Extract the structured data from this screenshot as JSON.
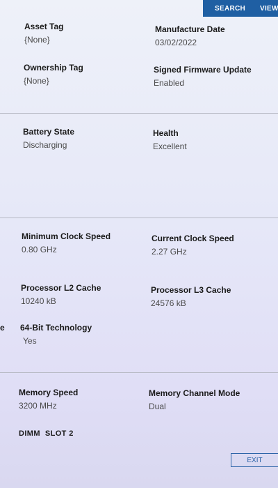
{
  "toolbar": {
    "search_label": "SEARCH",
    "view_all_label": "VIEW A"
  },
  "sections": {
    "asset": {
      "asset_tag": {
        "label": "Asset Tag",
        "value": "{None}"
      },
      "manufacture_date": {
        "label": "Manufacture Date",
        "value": "03/02/2022"
      },
      "ownership_tag": {
        "label": "Ownership Tag",
        "value": "{None}"
      },
      "signed_firmware_update": {
        "label": "Signed Firmware Update",
        "value": "Enabled"
      }
    },
    "battery": {
      "battery_state": {
        "label": "Battery State",
        "value": "Discharging"
      },
      "health": {
        "label": "Health",
        "value": "Excellent"
      }
    },
    "processor": {
      "min_clock_speed": {
        "label": "Minimum Clock Speed",
        "value": "0.80 GHz"
      },
      "current_clock_speed": {
        "label": "Current Clock Speed",
        "value": "2.27 GHz"
      },
      "l2_cache": {
        "label": "Processor L2 Cache",
        "value": "10240 kB"
      },
      "l3_cache": {
        "label": "Processor L3 Cache",
        "value": "24576 kB"
      },
      "bit64": {
        "label": "64-Bit Technology",
        "value": "Yes"
      },
      "cut_label": "e"
    },
    "memory": {
      "memory_speed": {
        "label": "Memory Speed",
        "value": "3200 MHz"
      },
      "channel_mode": {
        "label": "Memory Channel Mode",
        "value": "Dual"
      },
      "dimm_heading": "DIMM  SLOT 2"
    }
  },
  "footer": {
    "exit_label": "EXIT"
  }
}
